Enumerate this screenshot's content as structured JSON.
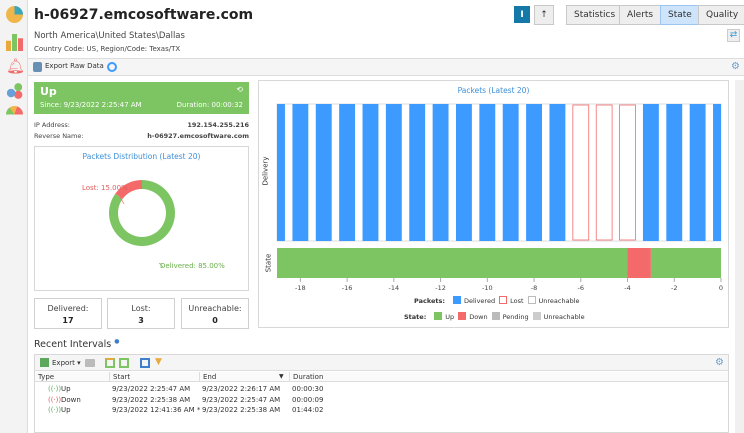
{
  "header": {
    "title": "h-06927.emcosoftware.com",
    "location": "North America\\United States\\Dallas",
    "country_info": "Country Code: US, Region/Code: Texas/TX",
    "buttons": [
      {
        "label": "I"
      },
      {
        "label": "↑"
      },
      {
        "label": "Statistics"
      },
      {
        "label": "Alerts"
      },
      {
        "label": "State",
        "active": true
      },
      {
        "label": "Quality"
      }
    ]
  },
  "sidebar": {
    "items": [
      "pie-chart-icon",
      "bar-chart-icon",
      "alarm-bell-icon",
      "status-icon",
      "gauge-icon"
    ]
  },
  "toolbar": {
    "export_raw": "Export Raw Data"
  },
  "status": {
    "state": "Up",
    "since": "Since: 9/23/2022 2:25:47 AM",
    "duration": "Duration: 00:00:32",
    "color": "#7dc462"
  },
  "info": {
    "ip_label": "IP Address:",
    "ip": "192.154.255.216",
    "rn_label": "Reverse Name:",
    "rn": "h-06927.emcosoftware.com"
  },
  "counts": [
    {
      "label": "Delivered:",
      "value": "17"
    },
    {
      "label": "Lost:",
      "value": "3"
    },
    {
      "label": "Unreachable:",
      "value": "0"
    }
  ],
  "chart_data": [
    {
      "type": "pie",
      "title": "Packets Distribution (Latest 20)",
      "slices": [
        {
          "name": "Lost",
          "value": 15.0,
          "label": "Lost: 15.00%",
          "color": "#f46a6a"
        },
        {
          "name": "Delivered",
          "value": 85.0,
          "label": "Delivered: 85.00%",
          "color": "#7dc462"
        }
      ]
    },
    {
      "type": "bar",
      "title": "Packets (Latest 20)",
      "ylabel_delivery": "Delivery",
      "ylabel_state": "State",
      "x": [
        -19,
        -18,
        -17,
        -16,
        -15,
        -14,
        -13,
        -12,
        -11,
        -10,
        -9,
        -8,
        -7,
        -6,
        -5,
        -4,
        -3,
        -2,
        -1,
        0
      ],
      "packets": [
        "Delivered",
        "Delivered",
        "Delivered",
        "Delivered",
        "Delivered",
        "Delivered",
        "Delivered",
        "Delivered",
        "Delivered",
        "Delivered",
        "Delivered",
        "Delivered",
        "Delivered",
        "Lost",
        "Lost",
        "Lost",
        "Delivered",
        "Delivered",
        "Delivered",
        "Delivered"
      ],
      "state_intervals": [
        {
          "from": -19,
          "to": -4,
          "state": "Up"
        },
        {
          "from": -4,
          "to": -3,
          "state": "Down"
        },
        {
          "from": -3,
          "to": 0,
          "state": "Up"
        }
      ],
      "xlim": [
        -19,
        0
      ],
      "xticks": [
        "-18",
        "-16",
        "-14",
        "-12",
        "-10",
        "-8",
        "-6",
        "-4",
        "-2",
        "0"
      ],
      "legend_packets": {
        "title": "Packets:",
        "items": [
          {
            "label": "Delivered",
            "color": "#3d9bff"
          },
          {
            "label": "Lost",
            "color": "#f46a6a"
          },
          {
            "label": "Unreachable",
            "color": "#bbbbbb"
          }
        ]
      },
      "legend_state": {
        "title": "State:",
        "items": [
          {
            "label": "Up",
            "color": "#7dc462"
          },
          {
            "label": "Down",
            "color": "#f46a6a"
          },
          {
            "label": "Pending",
            "color": "#bbbbbb"
          },
          {
            "label": "Unreachable",
            "color": "#cccccc"
          }
        ]
      }
    }
  ],
  "intervals": {
    "title": "Recent Intervals",
    "export": "Export",
    "columns": [
      "Type",
      "Start",
      "End",
      "Duration"
    ],
    "rows": [
      {
        "type": "Up",
        "start": "9/23/2022 2:25:47 AM",
        "end": "9/23/2022 2:26:17 AM",
        "duration": "00:00:30"
      },
      {
        "type": "Down",
        "start": "9/23/2022 2:25:38 AM",
        "end": "9/23/2022 2:25:47 AM",
        "duration": "00:00:09"
      },
      {
        "type": "Up",
        "start": "9/23/2022 12:41:36 AM *",
        "end": "9/23/2022 2:25:38 AM",
        "duration": "01:44:02"
      }
    ]
  }
}
